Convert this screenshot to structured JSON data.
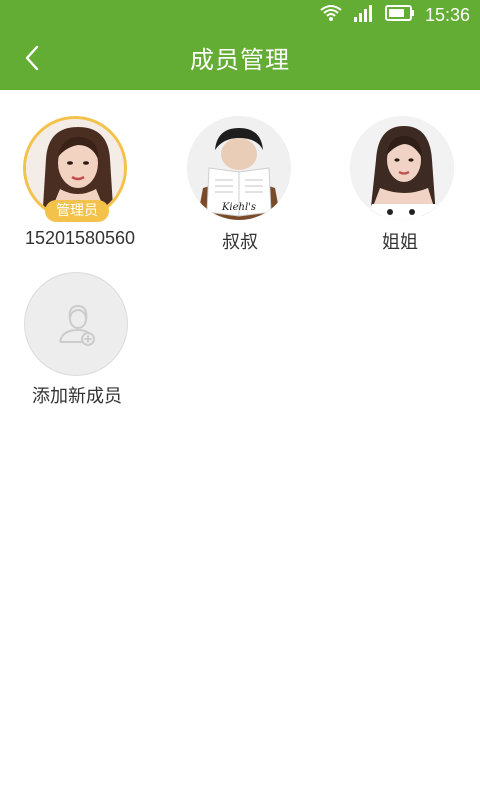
{
  "status_bar": {
    "time": "15:36",
    "icons": [
      "wifi-icon",
      "signal-icon",
      "battery-icon"
    ]
  },
  "nav": {
    "back_icon": "chevron-left-icon",
    "title": "成员管理"
  },
  "colors": {
    "primary": "#64ad34",
    "admin_badge": "#f3c24a",
    "text": "#333333"
  },
  "members": [
    {
      "name": "15201580560",
      "badge": "管理员",
      "avatar": "woman-portrait"
    },
    {
      "name": "叔叔",
      "avatar": "man-reading-book"
    },
    {
      "name": "姐姐",
      "avatar": "woman-portrait"
    }
  ],
  "add_member": {
    "label": "添加新成员",
    "icon": "add-user-icon"
  }
}
